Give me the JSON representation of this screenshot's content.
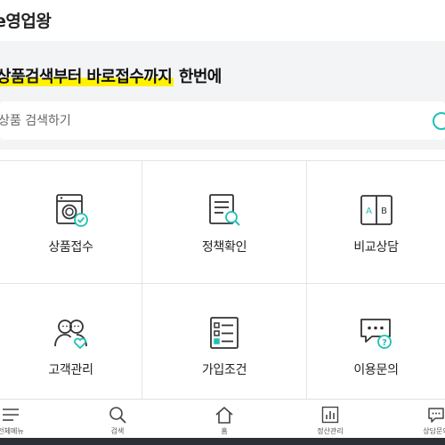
{
  "header": {
    "title": "e영업왕"
  },
  "banner": {
    "headline_highlight": "상품검색부터 바로접수까지",
    "headline_rest": " 한번에"
  },
  "search": {
    "placeholder": "상품 검색하기",
    "value": "",
    "accent_color": "#1ec1b4"
  },
  "menu": [
    {
      "label": "상품접수",
      "icon": "washing-machine-check-icon"
    },
    {
      "label": "정책확인",
      "icon": "document-search-icon"
    },
    {
      "label": "비교상담",
      "icon": "compare-ab-icon"
    },
    {
      "label": "고객관리",
      "icon": "customers-heart-icon"
    },
    {
      "label": "가입조건",
      "icon": "checklist-icon"
    },
    {
      "label": "이용문의",
      "icon": "chat-question-icon"
    }
  ],
  "nav": [
    {
      "label": "전체메뉴",
      "icon": "hamburger-menu-icon"
    },
    {
      "label": "검색",
      "icon": "search-icon"
    },
    {
      "label": "홈",
      "icon": "home-icon"
    },
    {
      "label": "정산관리",
      "icon": "bar-chart-icon"
    },
    {
      "label": "상담문의",
      "icon": "chat-bubble-icon"
    }
  ],
  "colors": {
    "highlight": "#fff200",
    "accent": "#1ec1b4",
    "panel_bg": "#f3f4f6"
  }
}
